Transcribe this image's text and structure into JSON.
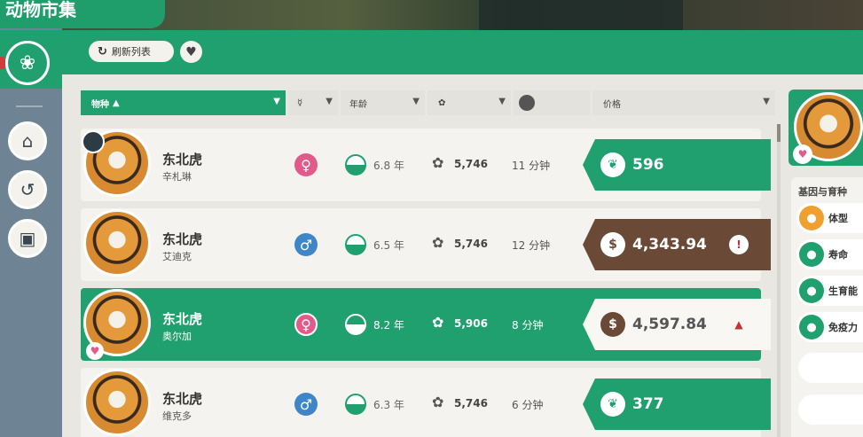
{
  "header": {
    "title": "动物市集",
    "refresh_label": "刷新列表",
    "refresh_icon": "refresh-icon",
    "favorite_icon": "heart-icon"
  },
  "sidebar": {
    "items": [
      {
        "icon": "paw-icon",
        "active": true
      },
      {
        "icon": "habitat-icon"
      },
      {
        "icon": "history-icon"
      },
      {
        "icon": "gift-icon"
      }
    ]
  },
  "columns": {
    "species": "物种",
    "species_sort": "▲",
    "gender_icon": "☿",
    "age": "年龄",
    "genes_icon": "ribbon-icon",
    "time_icon": "clock-icon",
    "price": "价格",
    "filter_icon": "▼"
  },
  "rows": [
    {
      "species": "东北虎",
      "owner": "辛札琳",
      "gender": "female",
      "gender_glyph": "♀",
      "age": "6.8 年",
      "genes": "5,746",
      "time": "11 分钟",
      "currency": "conservation-leaf",
      "currency_glyph": "❦",
      "price": "596",
      "price_style": "green",
      "warning": false,
      "pinned": true,
      "favorite": false,
      "selected": false
    },
    {
      "species": "东北虎",
      "owner": "艾迪克",
      "gender": "male",
      "gender_glyph": "♂",
      "age": "6.5 年",
      "genes": "5,746",
      "time": "12 分钟",
      "currency": "cash",
      "currency_glyph": "$",
      "price": "4,343.94",
      "price_style": "brown",
      "warning": true,
      "warning_glyph": "!",
      "pinned": false,
      "favorite": false,
      "selected": false
    },
    {
      "species": "东北虎",
      "owner": "奥尔加",
      "gender": "female",
      "gender_glyph": "♀",
      "age": "8.2 年",
      "genes": "5,906",
      "time": "8 分钟",
      "currency": "cash",
      "currency_glyph": "$",
      "price": "4,597.84",
      "price_style": "white",
      "warning": true,
      "warning_glyph": "▲",
      "pinned": false,
      "favorite": true,
      "selected": true
    },
    {
      "species": "东北虎",
      "owner": "维克多",
      "gender": "male",
      "gender_glyph": "♂",
      "age": "6.3 年",
      "genes": "5,746",
      "time": "6 分钟",
      "currency": "conservation-leaf",
      "currency_glyph": "❦",
      "price": "377",
      "price_style": "green",
      "warning": false,
      "pinned": false,
      "favorite": false,
      "selected": false
    }
  ],
  "details": {
    "section_title": "基因与育种",
    "items": [
      {
        "label": "体型",
        "icon": "size-icon",
        "color": "#f0a030"
      },
      {
        "label": "寿命",
        "icon": "hourglass-icon",
        "color": "#20a06e"
      },
      {
        "label": "生育能",
        "icon": "fertility-icon",
        "color": "#20a06e"
      },
      {
        "label": "免疫力",
        "icon": "immunity-icon",
        "color": "#20a06e"
      }
    ]
  },
  "colors": {
    "brand_green": "#20a06e",
    "price_brown": "#6a4a37",
    "female_pink": "#e05a8a",
    "male_blue": "#3f86c9",
    "warning_red": "#c93030"
  }
}
